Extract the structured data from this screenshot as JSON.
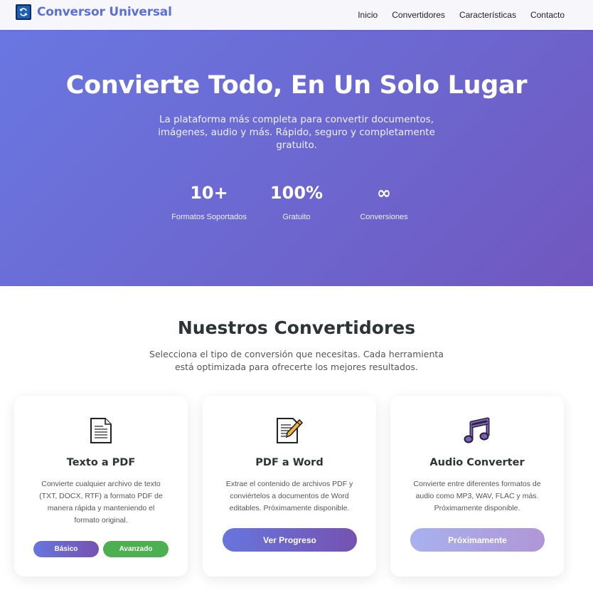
{
  "navbar": {
    "brand": "Conversor Universal",
    "links": [
      "Inicio",
      "Convertidores",
      "Características",
      "Contacto"
    ]
  },
  "hero": {
    "title": "Convierte Todo, En Un Solo Lugar",
    "subtitle": "La plataforma más completa para convertir documentos, imágenes, audio y más. Rápido, seguro y completamente gratuito.",
    "stats": [
      {
        "value": "10+",
        "label": "Formatos Soportados"
      },
      {
        "value": "100%",
        "label": "Gratuito"
      },
      {
        "value": "∞",
        "label": "Conversiones"
      }
    ]
  },
  "section": {
    "title": "Nuestros Convertidores",
    "subtitle": "Selecciona el tipo de conversión que necesitas. Cada herramienta está optimizada para ofrecerte los mejores resultados."
  },
  "cards": [
    {
      "icon": "document-icon",
      "title": "Texto a PDF",
      "description": "Convierte cualquier archivo de texto (TXT, DOCX, RTF) a formato PDF de manera rápida y manteniendo el formato original.",
      "buttons": [
        "Básico",
        "Avanzado"
      ]
    },
    {
      "icon": "memo-pencil-icon",
      "title": "PDF a Word",
      "description": "Extrae el contenido de archivos PDF y conviértelos a documentos de Word editables. Próximamente disponible.",
      "button": "Ver Progreso"
    },
    {
      "icon": "music-notes-icon",
      "title": "Audio Converter",
      "description": "Convierte entre diferentes formatos de audio como MP3, WAV, FLAC y más. Próximamente disponible.",
      "button": "Próximamente"
    }
  ],
  "colors": {
    "brand": "#5b6fd8",
    "hero_gradient_start": "#6a77e2",
    "hero_gradient_end": "#7057bf",
    "advanced_button": "#4caf50"
  }
}
